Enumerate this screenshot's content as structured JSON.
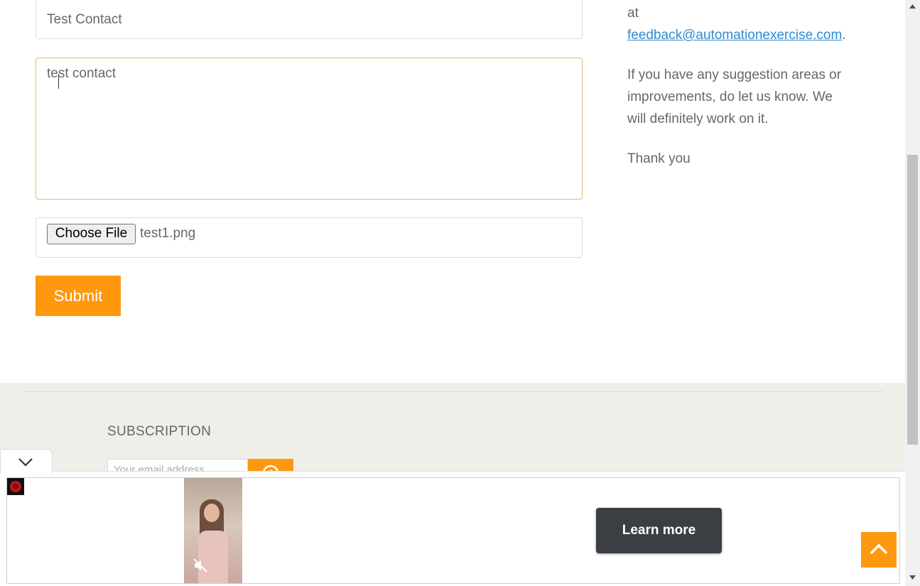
{
  "form": {
    "subject_value": "Test Contact",
    "message_value": "test contact",
    "file_button_label": "Choose File",
    "file_name": "test1.png",
    "submit_label": "Submit"
  },
  "info": {
    "at_text": "at",
    "email_link": "feedback@automationexercise.com",
    "email_suffix": ".",
    "suggestion_text": "If you have any suggestion areas or improvements, do let us know. We will definitely work on it.",
    "thanks_text": "Thank you"
  },
  "footer": {
    "subscription_title": "SUBSCRIPTION",
    "email_placeholder": "Your email address"
  },
  "ad": {
    "learn_more_label": "Learn more"
  },
  "colors": {
    "accent": "#fe980f",
    "link": "#2e8bd1",
    "footer_bg": "#efeee8"
  }
}
